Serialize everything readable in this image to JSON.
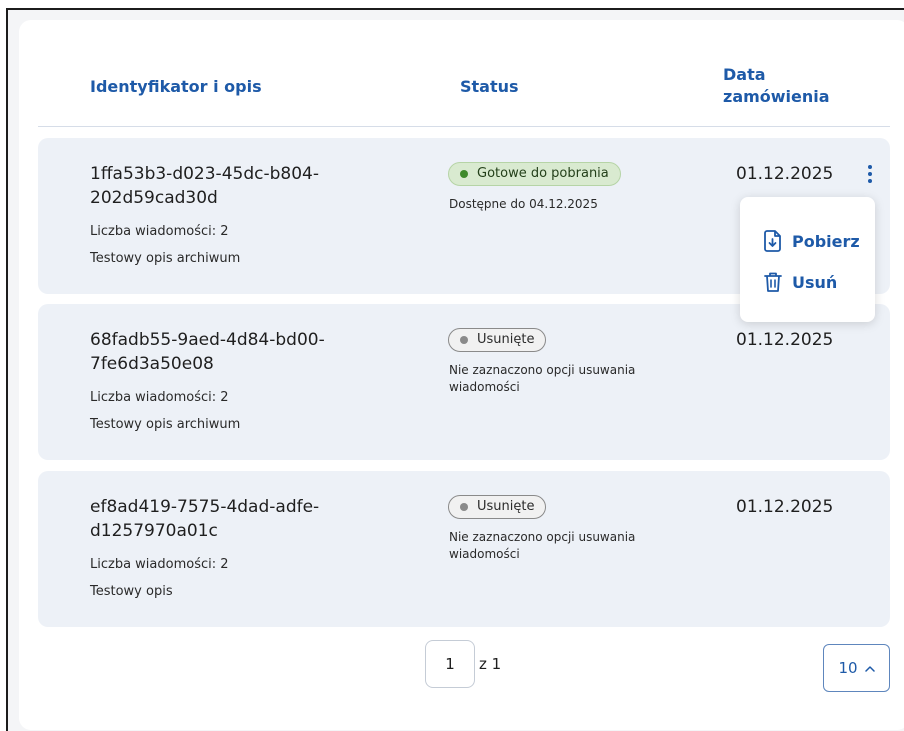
{
  "table": {
    "headers": {
      "id_desc": "Identyfikator i opis",
      "status": "Status",
      "order_date": "Data zamówienia"
    },
    "rows": [
      {
        "id": "1ffa53b3-d023-45dc-b804-202d59cad30d",
        "count": "Liczba wiadomości: 2",
        "description": "Testowy opis archiwum",
        "status": "Gotowe do pobrania",
        "status_note": "Dostępne do 04.12.2025",
        "date": "01.12.2025"
      },
      {
        "id": "68fadb55-9aed-4d84-bd00-7fe6d3a50e08",
        "count": "Liczba wiadomości: 2",
        "description": "Testowy opis archiwum",
        "status": "Usunięte",
        "status_note": "Nie zaznaczono opcji usuwania wiadomości",
        "date": "01.12.2025"
      },
      {
        "id": "ef8ad419-7575-4dad-adfe-d1257970a01c",
        "count": "Liczba wiadomości: 2",
        "description": "Testowy opis",
        "status": "Usunięte",
        "status_note": "Nie zaznaczono opcji usuwania wiadomości",
        "date": "01.12.2025"
      }
    ]
  },
  "menu": {
    "download": "Pobierz",
    "delete": "Usuń"
  },
  "pagination": {
    "current_page": "1",
    "total": "z 1",
    "per_page": "10"
  },
  "icons": {
    "kebab": "kebab-menu-icon",
    "download": "file-download-icon",
    "delete": "trash-icon",
    "per_page_chevron": "chevron-up-icon"
  },
  "colors": {
    "accent": "#1e5aa8",
    "row_background": "#edf1f7",
    "ready_badge": "#d9ead0",
    "ready_dot": "#3f8a2b",
    "deleted_badge": "#f1f1f1",
    "deleted_dot": "#8a8a8a"
  }
}
